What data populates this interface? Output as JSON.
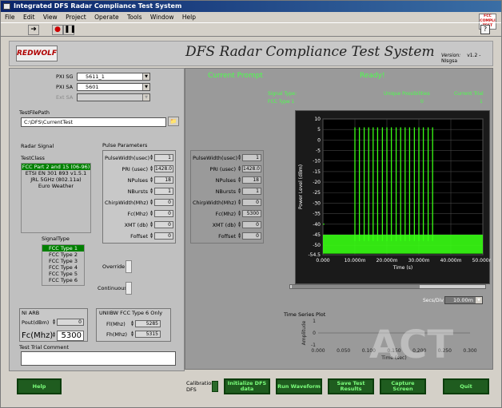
{
  "window": {
    "title": "Integrated DFS Radar Compliance Test System"
  },
  "menu": [
    "File",
    "Edit",
    "View",
    "Project",
    "Operate",
    "Tools",
    "Window",
    "Help"
  ],
  "fcc_badge": "FCC COMPLI TEST",
  "header": {
    "logo": "REDWOLF",
    "title": "DFS Radar Compliance Test System",
    "version_label": "Version:",
    "version_value": "v1.2 -NIsgsa"
  },
  "instruments": {
    "pxi_sg_label": "PXI SG",
    "pxi_sg_value": "5611_1",
    "pxi_sa_label": "PXI SA",
    "pxi_sa_value": "5601",
    "ext_sa_label": "Ext SA"
  },
  "testfile": {
    "label": "TestFilePath",
    "value": "C:\\DFS\\CurrentTest"
  },
  "radar_signal": {
    "label": "Radar Signal",
    "testclass_label": "TestClass",
    "testclass_items": [
      "FCC Part 2 and 15 (06-96)",
      "ETSI EN 301 893 v1.5.1",
      "JRL 5GHz (802.11a)",
      "Euro Weather"
    ],
    "signaltype_label": "SignalType",
    "signaltype_items": [
      "FCC Type 1",
      "FCC Type 2",
      "FCC Type 3",
      "FCC Type 4",
      "FCC Type 5",
      "FCC Type 6"
    ]
  },
  "pulse_params": {
    "label": "Pulse Parameters",
    "rows": [
      {
        "label": "PulseWidth(usec)",
        "value": "1"
      },
      {
        "label": "PRI (usec)",
        "value": "1428.0"
      },
      {
        "label": "NPulses",
        "value": "18"
      },
      {
        "label": "NBursts",
        "value": "1"
      },
      {
        "label": "ChirpWidth(Mhz)",
        "value": "0"
      },
      {
        "label": "Fc(Mhz)",
        "value": "0"
      },
      {
        "label": "XMT (db)",
        "value": "0"
      },
      {
        "label": "Foffset",
        "value": "0"
      }
    ]
  },
  "readback_params": {
    "rows": [
      {
        "label": "PulseWidth(usec)",
        "value": "1"
      },
      {
        "label": "PRI (usec)",
        "value": "1428.0"
      },
      {
        "label": "NPulses",
        "value": "18"
      },
      {
        "label": "NBursts",
        "value": "1"
      },
      {
        "label": "ChirpWidth(Mhz)",
        "value": "0"
      },
      {
        "label": "Fc(Mhz)",
        "value": "5300"
      },
      {
        "label": "XMT (db)",
        "value": "0"
      },
      {
        "label": "Foffset",
        "value": "0"
      }
    ]
  },
  "override_label": "Override",
  "continuous_label": "Continuous",
  "ni_arb": {
    "label": "NI ARB",
    "pout_label": "Pout(dBm)",
    "pout_value": "0",
    "fc_label": "Fc(Mhz)",
    "fc_value": "5300"
  },
  "unii": {
    "label": "UNIIBW FCC Type 6 Only",
    "fl_label": "Fl(Mhz)",
    "fl_value": "5285",
    "fh_label": "Fh(Mhz)",
    "fh_value": "5315"
  },
  "comment_label": "Test Trial Comment",
  "status": {
    "prompt_label": "Current Prompt",
    "prompt_value": "Ready!",
    "signal_type_label": "Signal Type:",
    "signal_type_value": "FCC Type 1",
    "unique_label": "Unique Possibilities",
    "unique_value": "0",
    "trial_label": "Current Trial",
    "trial_value": "1"
  },
  "plot": {
    "secs_div_label": "Secs/Div",
    "secs_div_value": "10.00m"
  },
  "chart_data": {
    "type": "line",
    "xlabel": "Time (s)",
    "ylabel": "Power Level (dBm)",
    "xlim": [
      0,
      0.05
    ],
    "ylim": [
      -54.5,
      10
    ],
    "x_ticks": [
      "0.000",
      "10.000m",
      "20.000m",
      "30.000m",
      "40.000m",
      "50.000m"
    ],
    "y_ticks": [
      "10",
      "5",
      "0",
      "-5",
      "-10",
      "-15",
      "-20",
      "-25",
      "-30",
      "-35",
      "-40",
      "-45",
      "-50",
      "-54.5"
    ],
    "series": [
      {
        "noise_floor_dbm": -48,
        "pulse_level_dbm": 6,
        "pulse_start_s": [
          0.01,
          0.0114,
          0.0129,
          0.0143,
          0.0157,
          0.0171,
          0.0186,
          0.02,
          0.0214,
          0.0229,
          0.0243,
          0.0257,
          0.0271,
          0.0286,
          0.03,
          0.0314,
          0.0329,
          0.0343
        ]
      }
    ],
    "color": "#39ff14"
  },
  "mini_plot": {
    "title": "Time Series Plot",
    "ylabel": "Amplitude",
    "xlabel": "Time (sec)",
    "x_ticks": [
      "0.000",
      "0.050",
      "0.100",
      "0.150",
      "0.200",
      "0.250",
      "0.300"
    ],
    "y_ticks": [
      "1",
      "0",
      "-1"
    ]
  },
  "buttons": {
    "help": "Help",
    "calibration": "Calibration DFS",
    "initialize": "Initialize DFS data",
    "run": "Run Waveform",
    "save": "Save Test Results",
    "capture": "Capture Screen",
    "quit": "Quit"
  },
  "watermark": "ACT"
}
